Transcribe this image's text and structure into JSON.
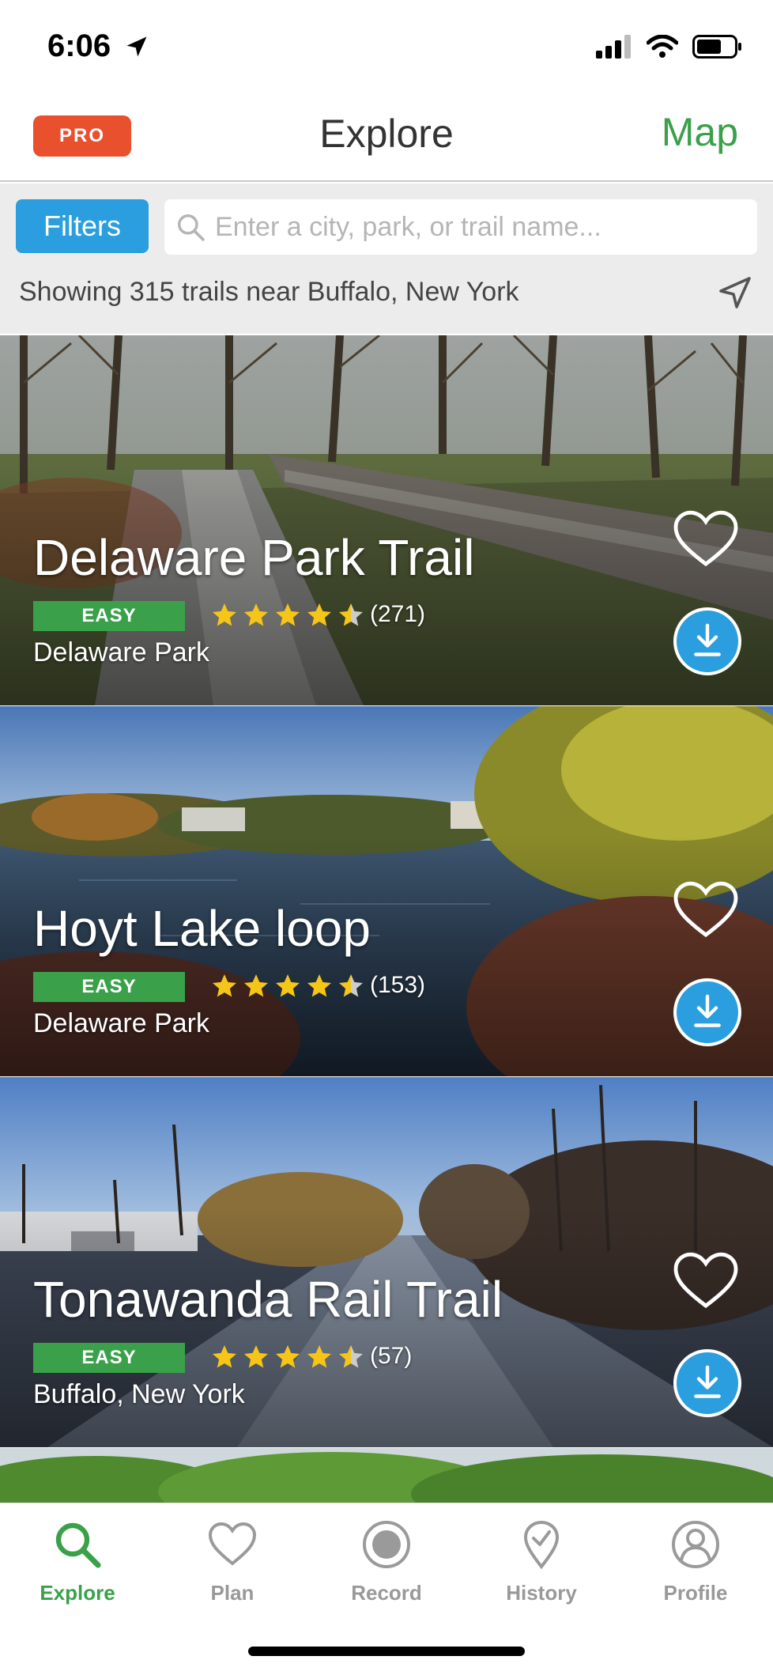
{
  "status_bar": {
    "time": "6:06"
  },
  "nav": {
    "pro_label": "PRO",
    "title": "Explore",
    "map_label": "Map"
  },
  "search": {
    "filters_label": "Filters",
    "placeholder": "Enter a city, park, or trail name...",
    "showing_text": "Showing 315 trails near Buffalo, New York"
  },
  "trails": [
    {
      "name": "Delaware Park Trail",
      "difficulty": "EASY",
      "rating": 4.5,
      "reviews": "(271)",
      "location": "Delaware Park"
    },
    {
      "name": "Hoyt Lake loop",
      "difficulty": "EASY",
      "rating": 4.5,
      "reviews": "(153)",
      "location": "Delaware Park"
    },
    {
      "name": "Tonawanda Rail Trail",
      "difficulty": "EASY",
      "rating": 4.5,
      "reviews": "(57)",
      "location": "Buffalo, New York"
    }
  ],
  "tabs": [
    {
      "label": "Explore",
      "icon": "search-icon",
      "active": true
    },
    {
      "label": "Plan",
      "icon": "heart-icon",
      "active": false
    },
    {
      "label": "Record",
      "icon": "record-icon",
      "active": false
    },
    {
      "label": "History",
      "icon": "check-pin-icon",
      "active": false
    },
    {
      "label": "Profile",
      "icon": "profile-icon",
      "active": false
    }
  ],
  "colors": {
    "brand_green": "#3aa14a",
    "pro_orange": "#e8502e",
    "action_blue": "#2a9ede",
    "star_yellow": "#f5c518"
  }
}
